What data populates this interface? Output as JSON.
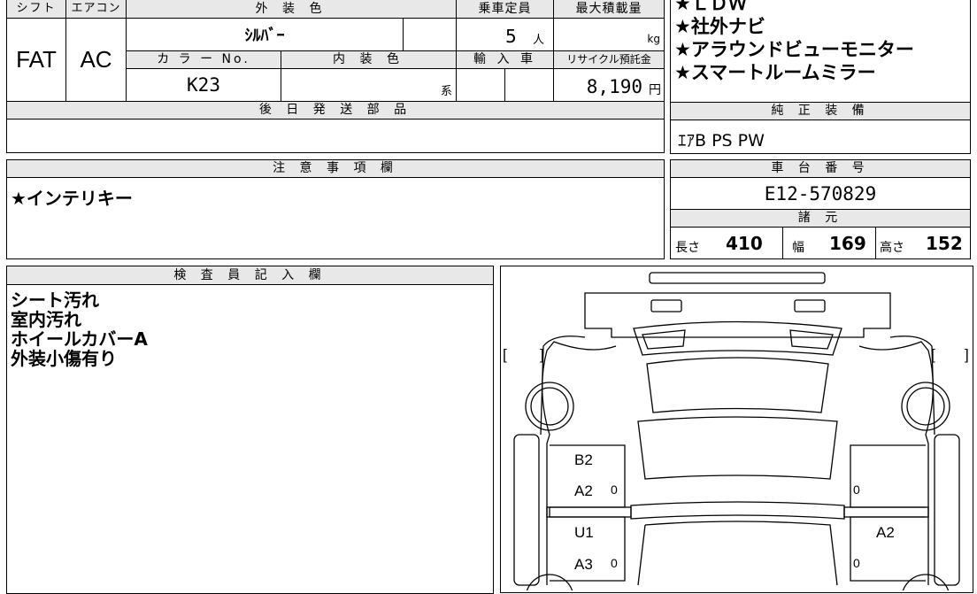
{
  "vehicle": {
    "shift_label": "シフト",
    "aircon_label": "エアコン",
    "exterior_color_label": "外 装 色",
    "capacity_label": "乗車定員",
    "max_load_label": "最大積載量",
    "shift": "FAT",
    "aircon": "AC",
    "exterior_color": "ｼﾙﾊﾞｰ",
    "capacity": "5",
    "capacity_unit": "人",
    "load_unit": "kg",
    "color_no_label": "カ ラ ー No.",
    "interior_color_label": "内 装 色",
    "import_label": "輸 入 車",
    "recycle_label": "リサイクル預託金",
    "color_no": "K23",
    "interior_suffix": "系",
    "recycle_fee": "8,190",
    "recycle_unit": "円"
  },
  "options": [
    "★ＬＤＷ",
    "★社外ナビ",
    "★アラウンドビューモニター",
    "★スマートルームミラー"
  ],
  "later_parts": {
    "label": "後 日 発 送 部 品",
    "value": ""
  },
  "genuine": {
    "label": "純 正 装 備",
    "value": "ｴｱB PS PW"
  },
  "caution": {
    "label": "注 意 事 項 欄",
    "value": "★インテリキー"
  },
  "chassis": {
    "label": "車 台 番 号",
    "value": "E12-570829"
  },
  "specs": {
    "label": "諸 元",
    "length_label": "長さ",
    "length": "410",
    "width_label": "幅",
    "width": "169",
    "height_label": "高さ",
    "height": "152"
  },
  "inspector": {
    "label": "検 査 員 記 入 欄",
    "notes": [
      "シート汚れ",
      "室内汚れ",
      "ホイールカバーA",
      "外装小傷有り"
    ]
  },
  "diagram": {
    "marks": {
      "left_top_1": "B2",
      "left_top_2": "A2",
      "left_top_zero": "0",
      "left_bot_1": "U1",
      "left_bot_2": "A3",
      "left_bot_zero": "0",
      "right_top_zero": "0",
      "right_bot_1": "A2",
      "right_bot_zero": "0"
    }
  }
}
